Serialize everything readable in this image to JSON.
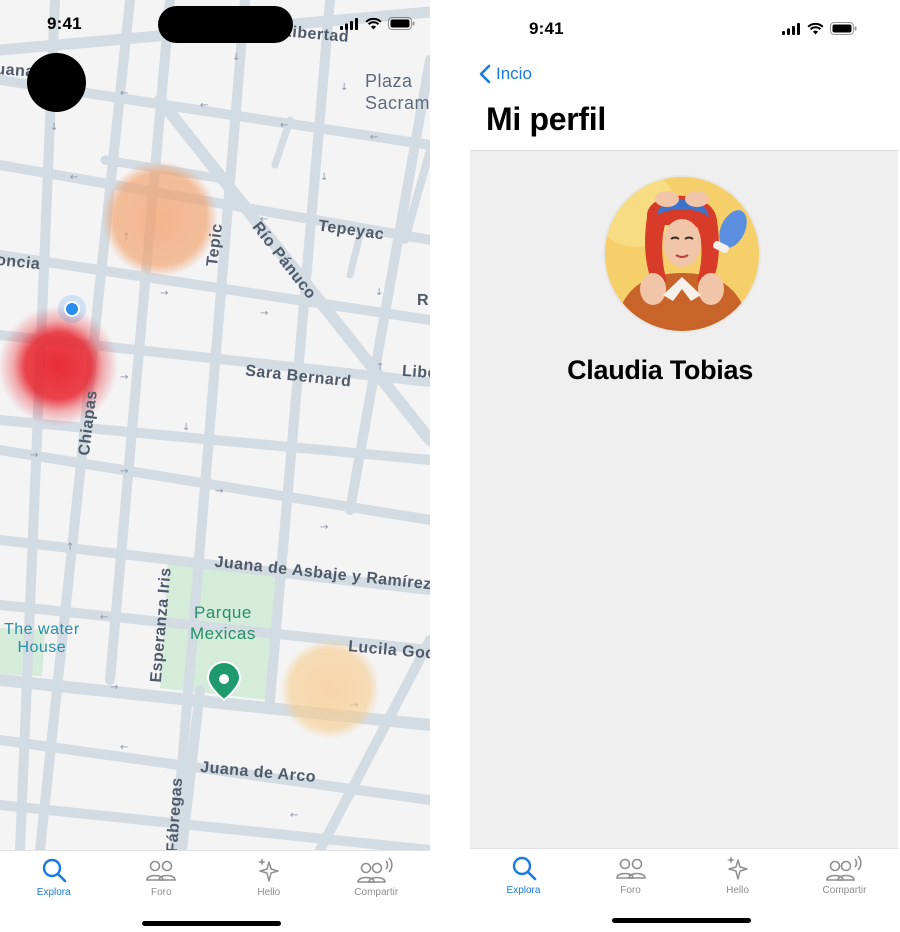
{
  "status_bar": {
    "time": "9:41"
  },
  "map": {
    "streets": [
      {
        "id": "libertad",
        "text": "Libertad"
      },
      {
        "id": "juana-left",
        "text": "Juana"
      },
      {
        "id": "tepeyac",
        "text": "Tepeyac"
      },
      {
        "id": "tepic",
        "text": "Tepic"
      },
      {
        "id": "rio-panuco",
        "text": "Río Pánuco"
      },
      {
        "id": "oncia",
        "text": "oncia"
      },
      {
        "id": "sara-bernard",
        "text": "Sara Bernard"
      },
      {
        "id": "lib-right",
        "text": "Libe"
      },
      {
        "id": "r-right",
        "text": "R"
      },
      {
        "id": "chiapas",
        "text": "Chiapas"
      },
      {
        "id": "juana-asbaje",
        "text": "Juana de Asbaje y Ramírez"
      },
      {
        "id": "esperanza-iris",
        "text": "Esperanza Iris"
      },
      {
        "id": "lucila-god",
        "text": "Lucila God"
      },
      {
        "id": "juana-arco",
        "text": "Juana de Arco"
      },
      {
        "id": "fabregas",
        "text": "Fábregas"
      }
    ],
    "plaza_label": "Plaza\nSacram",
    "park_label": "Parque\nMexicas",
    "poi_label": "The water\nHouse",
    "heat_colors": {
      "orange": "#f2a06a",
      "red": "#e8232c",
      "peach": "#f6cc8d"
    },
    "location_dot_color": "#2b8cf0",
    "marker_color": "#1f9a6e"
  },
  "tabs": [
    {
      "label": "Explora",
      "icon": "search-icon",
      "active": true
    },
    {
      "label": "Foro",
      "icon": "people-icon",
      "active": false
    },
    {
      "label": "Hello",
      "icon": "sparkle-icon",
      "active": false
    },
    {
      "label": "Compartir",
      "icon": "share-people-icon",
      "active": false
    }
  ],
  "profile": {
    "back_label": "Incio",
    "title": "Mi perfil",
    "name": "Claudia Tobias"
  },
  "colors": {
    "accent": "#1a7ae0",
    "inactive": "#8e8e93"
  }
}
